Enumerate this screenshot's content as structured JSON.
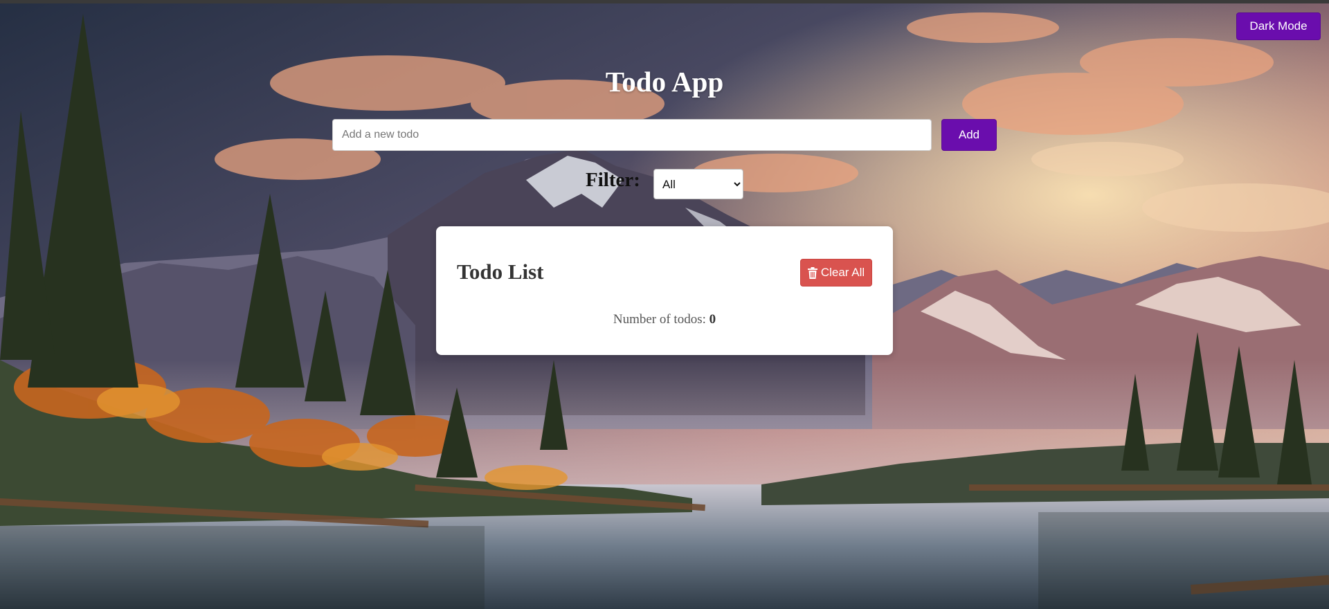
{
  "header": {
    "dark_mode_label": "Dark Mode",
    "title": "Todo App"
  },
  "add_form": {
    "placeholder": "Add a new todo",
    "value": "",
    "add_label": "Add"
  },
  "filter": {
    "label": "Filter:",
    "options": [
      "All"
    ],
    "selected": "All"
  },
  "todo_list": {
    "title": "Todo List",
    "clear_label": "Clear All",
    "clear_icon": "trash-icon",
    "count_label": "Number of todos:",
    "count_value": "0",
    "items": []
  },
  "colors": {
    "accent": "#6a0dad",
    "danger": "#d9534f",
    "card_bg": "#ffffff"
  }
}
